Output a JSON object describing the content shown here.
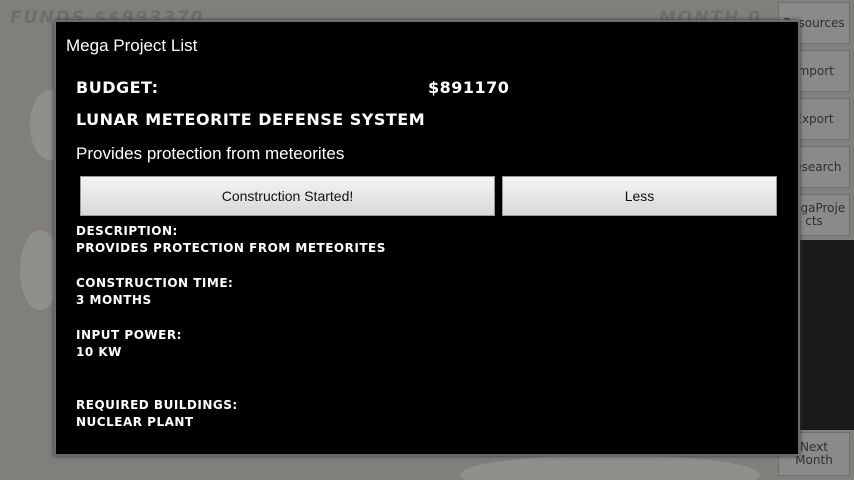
{
  "background": {
    "funds_text": "FUNDS $$993370",
    "month_text": "MONTH 0",
    "side_buttons": [
      "Resources",
      "Import",
      "Export",
      "Research",
      "MegaProje cts"
    ],
    "next_month": "Next Month"
  },
  "dialog": {
    "title": "Mega Project List",
    "budget_label": "BUDGET:",
    "budget_value": "$891170",
    "project_name": "LUNAR METEORITE DEFENSE SYSTEM",
    "project_summary": "Provides protection from meteorites",
    "buttons": {
      "construction": "Construction Started!",
      "less": "Less"
    },
    "fields": [
      {
        "label": "DESCRIPTION:",
        "value": "PROVIDES PROTECTION FROM METEORITES"
      },
      {
        "label": "CONSTRUCTION TIME:",
        "value": "3 MONTHS"
      },
      {
        "label": "INPUT POWER:",
        "value": "10 KW"
      },
      {
        "label": "REQUIRED BUILDINGS:",
        "value": "NUCLEAR PLANT"
      }
    ]
  }
}
